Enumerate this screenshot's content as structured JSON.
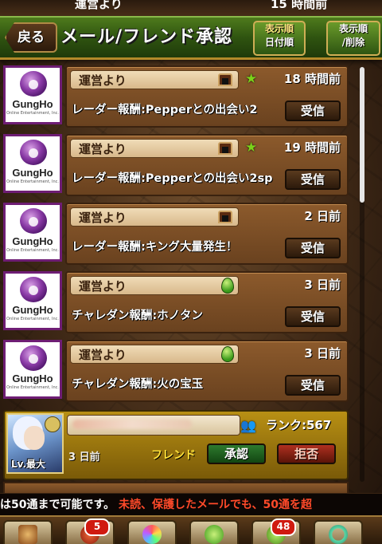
{
  "header": {
    "back_label": "戻る",
    "title": "メール/フレンド承認",
    "sort_button": {
      "line1": "表示順",
      "line2": "日付順"
    },
    "sort_delete_button": {
      "line1": "表示順",
      "line2": "/削除"
    }
  },
  "top_strip": {
    "sender": "運営より",
    "time": "15 時間前"
  },
  "mails": [
    {
      "sender": "運営より",
      "icon": "gate-icon",
      "starred": true,
      "time": "18 時間前",
      "subject": "レーダー報酬:Pepperとの出会い2",
      "button": "受信"
    },
    {
      "sender": "運営より",
      "icon": "gate-icon",
      "starred": true,
      "time": "19 時間前",
      "subject": "レーダー報酬:Pepperとの出会い2sp",
      "button": "受信"
    },
    {
      "sender": "運営より",
      "icon": "gate-icon",
      "starred": false,
      "time": "2 日前",
      "subject": "レーダー報酬:キング大量発生！",
      "button": "受信"
    },
    {
      "sender": "運営より",
      "icon": "egg-icon",
      "starred": false,
      "time": "3 日前",
      "subject": "チャレダン報酬:ホノタン",
      "button": "受信"
    },
    {
      "sender": "運営より",
      "icon": "egg-icon",
      "starred": false,
      "time": "3 日前",
      "subject": "チャレダン報酬:火の宝玉",
      "button": "受信"
    }
  ],
  "logo": {
    "name": "GungHo",
    "sub": "Online Entertainment, Inc."
  },
  "friend_request": {
    "level": "Lv.最大",
    "rank": "ランク:567",
    "days": "3 日前",
    "type": "フレンド",
    "approve": "承認",
    "reject": "拒否"
  },
  "ticker": {
    "part1": "は50通まで可能です。",
    "part2": "未読、保護したメールでも、50通を超"
  },
  "bottom_nav": [
    {
      "icon": "home-icon",
      "badge": ""
    },
    {
      "icon": "dragon-icon",
      "badge": "5"
    },
    {
      "icon": "gem-icon",
      "badge": ""
    },
    {
      "icon": "egg-icon",
      "badge": ""
    },
    {
      "icon": "friend-icon",
      "badge": "48"
    },
    {
      "icon": "ring-icon",
      "badge": ""
    }
  ],
  "colors": {
    "header_green": "#2f5410",
    "card_brown": "#6a421f",
    "friend_gold": "#b89014",
    "ticker_red": "#ff4a2a"
  }
}
